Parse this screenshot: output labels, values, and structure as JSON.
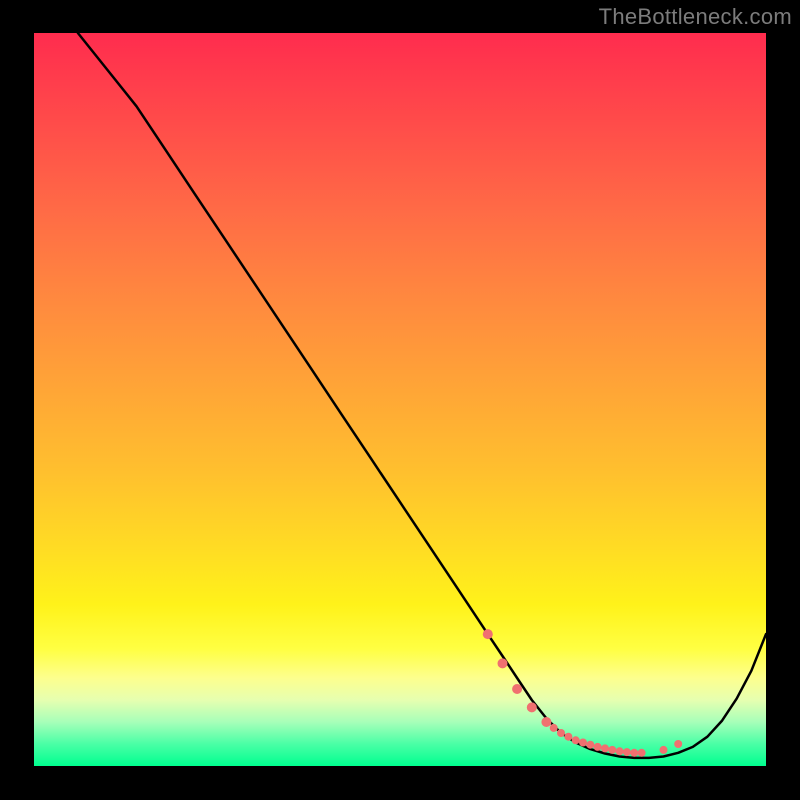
{
  "watermark": "TheBottleneck.com",
  "chart_data": {
    "type": "line",
    "title": "",
    "xlabel": "",
    "ylabel": "",
    "xlim": [
      0,
      100
    ],
    "ylim": [
      0,
      100
    ],
    "grid": false,
    "series": [
      {
        "name": "bottleneck-curve",
        "color": "#000000",
        "x": [
          6,
          10,
          14,
          18,
          22,
          26,
          30,
          34,
          38,
          42,
          46,
          50,
          54,
          58,
          62,
          64,
          66,
          68,
          70,
          72,
          74,
          76,
          78,
          80,
          82,
          84,
          86,
          88,
          90,
          92,
          94,
          96,
          98,
          100
        ],
        "values": [
          100,
          95,
          90,
          84,
          78,
          72,
          66,
          60,
          54,
          48,
          42,
          36,
          30,
          24,
          18,
          15,
          12,
          9,
          6.5,
          4.5,
          3.2,
          2.3,
          1.7,
          1.3,
          1.1,
          1.1,
          1.3,
          1.8,
          2.6,
          4.0,
          6.2,
          9.2,
          13.0,
          18.0
        ]
      }
    ],
    "markers": {
      "name": "highlighted-points",
      "color": "#f07070",
      "x": [
        62,
        64,
        66,
        68,
        70,
        71,
        72,
        73,
        74,
        75,
        76,
        77,
        78,
        79,
        80,
        81,
        82,
        83,
        86,
        88
      ],
      "values": [
        18,
        14,
        10.5,
        8,
        6,
        5.2,
        4.5,
        4.0,
        3.5,
        3.2,
        2.9,
        2.6,
        2.4,
        2.2,
        2.0,
        1.9,
        1.8,
        1.8,
        2.2,
        3.0
      ],
      "radius": [
        5,
        5,
        5,
        5,
        5,
        4,
        4,
        4,
        4,
        4,
        4,
        4,
        4,
        4,
        4,
        4,
        4,
        4,
        4,
        4
      ]
    }
  },
  "plot": {
    "inner_x": 34,
    "inner_y": 33,
    "inner_w": 732,
    "inner_h": 733
  }
}
